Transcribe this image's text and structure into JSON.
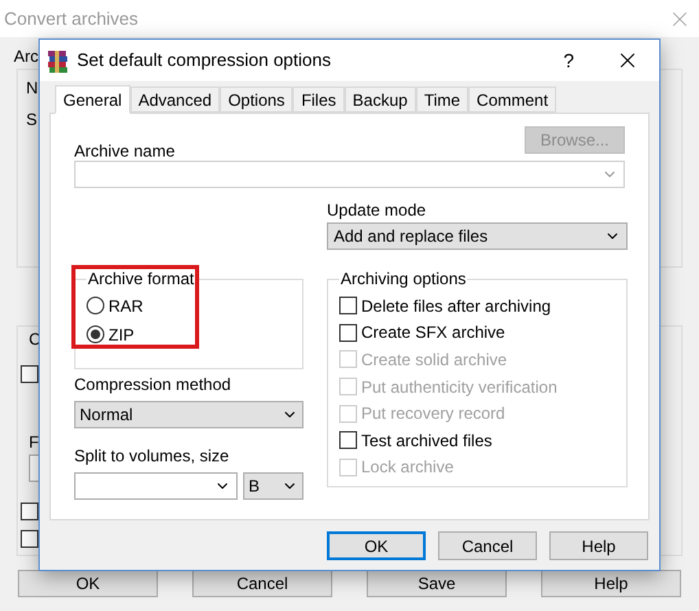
{
  "background_window": {
    "title": "Convert archives",
    "label_fragments": [
      "Arc",
      "N",
      "S",
      "C",
      "F"
    ],
    "checkboxes": [
      {
        "checked": false
      },
      {
        "checked": false
      },
      {
        "checked": false
      }
    ],
    "buttons": [
      "OK",
      "Cancel",
      "Save",
      "Help"
    ]
  },
  "dialog": {
    "title": "Set default compression options",
    "help": "?",
    "tabs": [
      {
        "label": "General",
        "selected": true
      },
      {
        "label": "Advanced",
        "selected": false
      },
      {
        "label": "Options",
        "selected": false
      },
      {
        "label": "Files",
        "selected": false
      },
      {
        "label": "Backup",
        "selected": false
      },
      {
        "label": "Time",
        "selected": false
      },
      {
        "label": "Comment",
        "selected": false
      }
    ],
    "archive_name": {
      "label": "Archive name",
      "browse": "Browse...",
      "browse_disabled": true
    },
    "update_mode": {
      "label": "Update mode",
      "value": "Add and replace files"
    },
    "archive_format": {
      "label": "Archive format",
      "highlighted": true,
      "options": [
        {
          "label": "RAR",
          "selected": false
        },
        {
          "label": "ZIP",
          "selected": true
        }
      ]
    },
    "compression_method": {
      "label": "Compression method",
      "value": "Normal"
    },
    "split": {
      "label": "Split to volumes, size",
      "unit": "B"
    },
    "archiving_options": {
      "label": "Archiving options",
      "options": [
        {
          "label": "Delete files after archiving",
          "checked": false,
          "disabled": false
        },
        {
          "label": "Create SFX archive",
          "checked": false,
          "disabled": false
        },
        {
          "label": "Create solid archive",
          "checked": false,
          "disabled": true
        },
        {
          "label": "Put authenticity verification",
          "checked": false,
          "disabled": true
        },
        {
          "label": "Put recovery record",
          "checked": false,
          "disabled": true
        },
        {
          "label": "Test archived files",
          "checked": false,
          "disabled": false
        },
        {
          "label": "Lock archive",
          "checked": false,
          "disabled": true
        }
      ]
    },
    "buttons": [
      {
        "label": "OK",
        "default": true
      },
      {
        "label": "Cancel",
        "default": false
      },
      {
        "label": "Help",
        "default": false
      }
    ]
  }
}
